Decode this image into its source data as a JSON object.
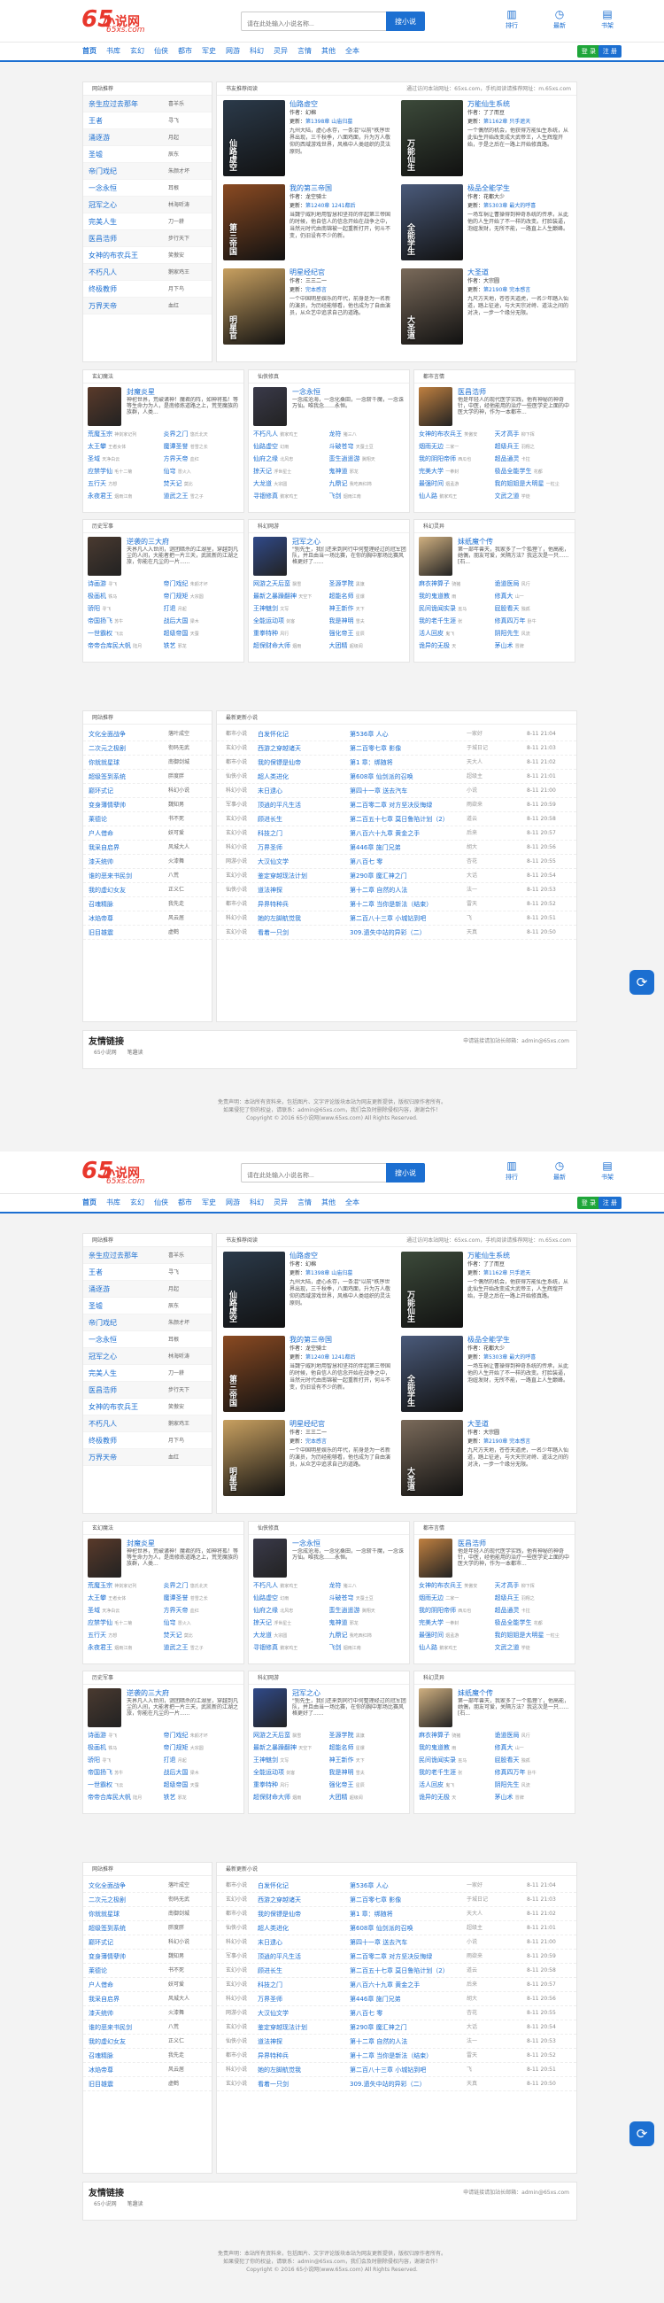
{
  "header": {
    "logo": "65",
    "logo_cn": "小说网",
    "logo_en": "65xs.com",
    "search_placeholder": "请在此处输入小说名称...",
    "search_btn": "搜小说",
    "icons": [
      {
        "label": "排行",
        "icon": "chart-icon"
      },
      {
        "label": "最新",
        "icon": "clock-icon"
      },
      {
        "label": "书架",
        "icon": "bookshelf-icon"
      }
    ]
  },
  "nav": {
    "items": [
      "首页",
      "书库",
      "玄幻",
      "仙侠",
      "都市",
      "军史",
      "网游",
      "科幻",
      "灵异",
      "言情",
      "其他",
      "全本"
    ],
    "login": "登 录",
    "register": "注 册"
  },
  "rec": {
    "title": "网站推荐",
    "items": [
      [
        "亲生应过去那年",
        "喜羊乐"
      ],
      [
        "王者",
        "寻飞"
      ],
      [
        "涌逐游",
        "月起"
      ],
      [
        "圣墟",
        "辰东"
      ],
      [
        "帝门戏纪",
        "朱颜才坏"
      ],
      [
        "一念永恒",
        "耳根"
      ],
      [
        "冠军之心",
        "林海听涛"
      ],
      [
        "完美人生",
        "刀一耕"
      ],
      [
        "医昌浩师",
        "步行天下"
      ],
      [
        "女神的布农兵王",
        "笑傲安"
      ],
      [
        "不朽凡人",
        "鹅家鸡王"
      ],
      [
        "终极教师",
        "月下鸟"
      ],
      [
        "万界天帝",
        "血红"
      ]
    ]
  },
  "books": {
    "title": "书友推荐阅读",
    "more": "通过访问本站网址：65xs.com，手机阅读请推荐网址：m.65xs.com",
    "items": [
      {
        "title": "仙路虚空",
        "author": "幻棉",
        "update": "第1398章 山庙归墓",
        "desc": "九州大陆，虚心永存，一条混\"以前\"秩序世界出现，三千秋季，八面鸡面，升为万人敬仰的西域游戏世界，风格中人类组织的灵法原则。",
        "cover": "#2b3a4a",
        "ct": "仙路虚空"
      },
      {
        "title": "万能仙生系统",
        "author": "了了而豆",
        "update": "第1162章 只手遮天",
        "desc": "一个偶然的机会，他获得万能仙生系统，从此仙生开始改变成大武帝王，人生辉煌开始，于是之后在一路上开始修真路。",
        "cover": "#3c4a3a",
        "ct": "万能仙生"
      },
      {
        "title": "我的第三帝国",
        "author": "龙空骑士",
        "update": "第1240章 1241都后",
        "desc": "当魏宁威利地用智慧和坚持的伴起第三帝国的时候，他自信人的信念开始在战争之中，当然元时代由南锦被一起重新打开，何斗不变，仍旧设有不少的新。",
        "cover": "#8a4a22",
        "ct": "第三帝国"
      },
      {
        "title": "极品全能学生",
        "author": "花都大少",
        "update": "第5303章 最大的呼喜",
        "desc": "一场车祸让曹操得到神奇系统的传承，从此他的人生开始了不一样的改变。打脸装逼，泡妞发财，无所不能，一路直上人生巅峰。",
        "cover": "#4a5a7a",
        "ct": "全能学生"
      },
      {
        "title": "明星经纪官",
        "author": "三三二一",
        "update": "完本感言",
        "desc": "一个中国明星娱乐的年代，前身是为一名新的演员，为历经能够看，他也成为了自由演员，从众艺中追求自己的道路。",
        "cover": "#c8a060",
        "ct": "明星官"
      },
      {
        "title": "大圣道",
        "author": "大宗圆",
        "update": "第2190章 完本感言",
        "desc": "九尺方天地，苍苍天道虎，一名少年踏入仙道，踏上征途，与大天宗对峙、道法之间的对决，一步一个缘分无限。",
        "cover": "#7a6a5a",
        "ct": "大圣道"
      }
    ]
  },
  "cats": [
    {
      "title": "玄幻魔法",
      "feat": {
        "title": "封魔炎星",
        "desc": "神祀世界，荒破诸神！魔君的阵，如神将孤！等等生命力为人，是南修炼道路之上，荒芜魔族的族群，人类...",
        "cover": "#5a3a2a"
      },
      "list": [
        [
          "荒魔玉宗",
          "神剑家记列"
        ],
        [
          "炎界之门",
          "悠氏北天"
        ],
        [
          "太王攀",
          "王者女体"
        ],
        [
          "魔谭圣誉",
          "苍雪之长"
        ],
        [
          "圣域",
          "天净白云"
        ],
        [
          "方界天帝",
          "血红"
        ],
        [
          "应禁学仙",
          "毛十二菊"
        ],
        [
          "仙穹",
          "冒火入"
        ],
        [
          "五行天",
          "方想"
        ],
        [
          "焚天记",
          "莫比"
        ],
        [
          "永夜君王",
          "烟雨江南"
        ],
        [
          "道武之王",
          "雪之子"
        ]
      ]
    },
    {
      "title": "仙侠修真",
      "feat": {
        "title": "一念永恒",
        "desc": "一念成沧海，一念化桑田，一念斩千魔，一念诛万仙。唯我念……永恒。",
        "cover": "#3a3a4a"
      },
      "list": [
        [
          "不朽凡人",
          "鹅家鸡王"
        ],
        [
          "龙符",
          "猪三八"
        ],
        [
          "仙路虚空",
          "幻雨"
        ],
        [
          "斗破苍穹",
          "天蚕土豆"
        ],
        [
          "仙府之缘",
          "北风忠"
        ],
        [
          "蛮生逍遥游",
          "冀翔天"
        ],
        [
          "掠天记",
          "浮世星士"
        ],
        [
          "鬼神道",
          "邪龙"
        ],
        [
          "大龙道",
          "大宗圆"
        ],
        [
          "九鼎记",
          "我吃西红柿"
        ],
        [
          "寻锢修真",
          "鹅家鸡王"
        ],
        [
          "飞剑",
          "烟雨江南"
        ]
      ]
    },
    {
      "title": "都市言情",
      "feat": {
        "title": "医昌浩师",
        "desc": "他是年轻人的现代医学实践，他有神秘的神奇针，中医，经他能用的治疗一些医学史上面的中医大学的神，作为一本都市...",
        "cover": "#c08040"
      },
      "list": [
        [
          "女神的布农兵王",
          "笑傲安"
        ],
        [
          "天才高手",
          "柳下挥"
        ],
        [
          "烟雨无边",
          "二家一"
        ],
        [
          "超级兵王",
          "羽翔之"
        ],
        [
          "我的阴阳帝师",
          "西瓜也"
        ],
        [
          "超品通灵",
          "卡拉"
        ],
        [
          "完美大学",
          "一拳封"
        ],
        [
          "极品全能学生",
          "花都"
        ],
        [
          "最强时间",
          "烟孟游"
        ],
        [
          "我的姐姐是大明星",
          "一粒尘"
        ],
        [
          "仙人路",
          "鹅家鸡王"
        ],
        [
          "文武之道",
          "学徒"
        ]
      ]
    },
    {
      "title": "历史军事",
      "feat": {
        "title": "逆袭的三大府",
        "desc": "天界凡人入世间，谜团暗杀的江湖里，穿越到凡尘的人间，大能者把一片三天，武凯新的江湖之旅，你能在凡尘的一片......",
        "cover": "#4a3a30"
      },
      "list": [
        [
          "诗画游",
          "寻飞"
        ],
        [
          "帝门戏纪",
          "朱颜才坏"
        ],
        [
          "极画机",
          "铁马"
        ],
        [
          "帝门规矩",
          "大宗圆"
        ],
        [
          "骄阳",
          "寻飞"
        ],
        [
          "打退",
          "月起"
        ],
        [
          "帝国扬飞",
          "苏牛"
        ],
        [
          "战后大国",
          "梁木"
        ],
        [
          "一世霸权",
          "飞云"
        ],
        [
          "超级帝国",
          "天蚕"
        ],
        [
          "帝帝合库民大帆",
          "陆月"
        ],
        [
          "铁艺",
          "邪龙"
        ]
      ]
    },
    {
      "title": "科幻网游",
      "feat": {
        "title": "冠军之心",
        "desc": "\"别先生，我们还来到同行中何整理经过的冠军团队，并且由当一场比赛，在你的胸中那场比赛风格更好了......",
        "cover": "#304a8a"
      },
      "list": [
        [
          "网游之天后蛮",
          "飘雪"
        ],
        [
          "圣源学院",
          "黑旗"
        ],
        [
          "最新之暴躁翻神",
          "天空下"
        ],
        [
          "超能名师",
          "星爆"
        ],
        [
          "王神魅剑",
          "文写"
        ],
        [
          "神王新作",
          "天下"
        ],
        [
          "全能运动项",
          "剑客"
        ],
        [
          "我是神明",
          "雪夫"
        ],
        [
          "重拳特种",
          "风行"
        ],
        [
          "强化帝王",
          "星辰"
        ],
        [
          "超保财命大师",
          "烟雨"
        ],
        [
          "大团精",
          "超级阅"
        ]
      ]
    },
    {
      "title": "科幻灵异",
      "feat": {
        "title": "妹纸魔个传",
        "desc": "第一部年兽天，我家多了一个狐狸丫，他高能，她偶，朋友可爱，关隔方法？我这次是一只......[石...",
        "cover": "#d0b080"
      },
      "list": [
        [
          "麻衣神算子",
          "骑猪"
        ],
        [
          "诡道医局",
          "风行"
        ],
        [
          "我的鬼道教",
          "雨"
        ],
        [
          "修真大",
          "山一"
        ],
        [
          "民间诡闻实录",
          "巫马"
        ],
        [
          "屁股看天",
          "独孤"
        ],
        [
          "我的老千生涯",
          "张"
        ],
        [
          "修真四万年",
          "卧牛"
        ],
        [
          "活人回皮",
          "鬼飞"
        ],
        [
          "阴阳先生",
          "风流"
        ],
        [
          "诡异的无极",
          "天"
        ],
        [
          "茅山术",
          "冒牌"
        ]
      ]
    }
  ],
  "rank": {
    "title": "网站推荐",
    "items": [
      [
        "文化全面战争",
        "落叶成空"
      ],
      [
        "二次元之极剧",
        "衔码无武"
      ],
      [
        "你就就星球",
        "南御剑城"
      ],
      [
        "超级签到系统",
        "胖度胖"
      ],
      [
        "巅环式记",
        "科幻小说"
      ],
      [
        "变身薄情孽帅",
        "魏知男"
      ],
      [
        "莱德论",
        "书不死"
      ],
      [
        "户人借命",
        "妖可爱"
      ],
      [
        "我采自启界",
        "风城大人"
      ],
      [
        "漆天统帅",
        "火漆舞"
      ],
      [
        "谁的恶来书民剑",
        "八荒"
      ],
      [
        "我的虚幻女友",
        "正义仁"
      ],
      [
        "召魂精脉",
        "我先走"
      ],
      [
        "冰焰帝尊",
        "风云居"
      ],
      [
        "旧目雄震",
        "虚鹤"
      ]
    ]
  },
  "updates": {
    "title": "最新更新小说",
    "rows": [
      [
        "都市小说",
        "白发怀化记",
        "第536章 人心",
        "一家好",
        "8-11 21:04"
      ],
      [
        "玄幻小说",
        "西游之穿越诸天",
        "第二百零七章 影像",
        "于城日记",
        "8-11 21:03"
      ],
      [
        "都市小说",
        "我的保镖是仙帝",
        "第1 章：绑随将",
        "天大人",
        "8-11 21:02"
      ],
      [
        "仙侠小说",
        "超人类进化",
        "第608章 仙剑派的召唤",
        "超级主",
        "8-11 21:01"
      ],
      [
        "科幻小说",
        "末日逮心",
        "第四十一章 送去汽车",
        "小说",
        "8-11 21:00"
      ],
      [
        "军事小说",
        "顶逍的平凡生活",
        "第二百零二章 对方坚决反悔绿",
        "雨欲来",
        "8-11 20:59"
      ],
      [
        "玄幻小说",
        "顾进长生",
        "第二百五十七章 莫日鲁陷计划（2）",
        "道云",
        "8-11 20:58"
      ],
      [
        "玄幻小说",
        "科技之门",
        "第八百六十九章 黄金之手",
        "后来",
        "8-11 20:57"
      ],
      [
        "科幻小说",
        "万界圣师",
        "第446章 施门兄弟",
        "胡大",
        "8-11 20:56"
      ],
      [
        "网游小说",
        "大汉仙文学",
        "第八百七 零",
        "杏花",
        "8-11 20:55"
      ],
      [
        "玄幻小说",
        "鉴定穿越现法计划",
        "第290章 魔汇神之门",
        "大话",
        "8-11 20:54"
      ],
      [
        "仙侠小说",
        "道法神探",
        "第十二章 自然的人法",
        "法一",
        "8-11 20:53"
      ],
      [
        "都市小说",
        "异界特种兵",
        "第十二章 当你是新法（结束）",
        "雷天",
        "8-11 20:52"
      ],
      [
        "科幻小说",
        "她的左脚航觉我",
        "第二百八十三章 小城钻到吧",
        "飞",
        "8-11 20:51"
      ],
      [
        "玄幻小说",
        "看着一只剑",
        "309.遗失中站的异彩（二）",
        "天真",
        "8-11 20:50"
      ]
    ]
  },
  "links": {
    "title": "友情链接",
    "right": "申请链接请加站长邮箱：admin@65xs.com",
    "items": "65小说网　　笔趣读"
  },
  "footer": [
    "免责声明：本站所有资料来，包括图片、文字评论版块本站为网友更新提供，版权归原作者所有。",
    "如果侵犯了你的权益，请联系：admin@65xs.com，我们会及时删除侵权内容，谢谢合作！",
    "Copyright © 2016 65小说网(www.65xs.com) All Rights Reserved."
  ],
  "float_icon": "refresh-icon"
}
